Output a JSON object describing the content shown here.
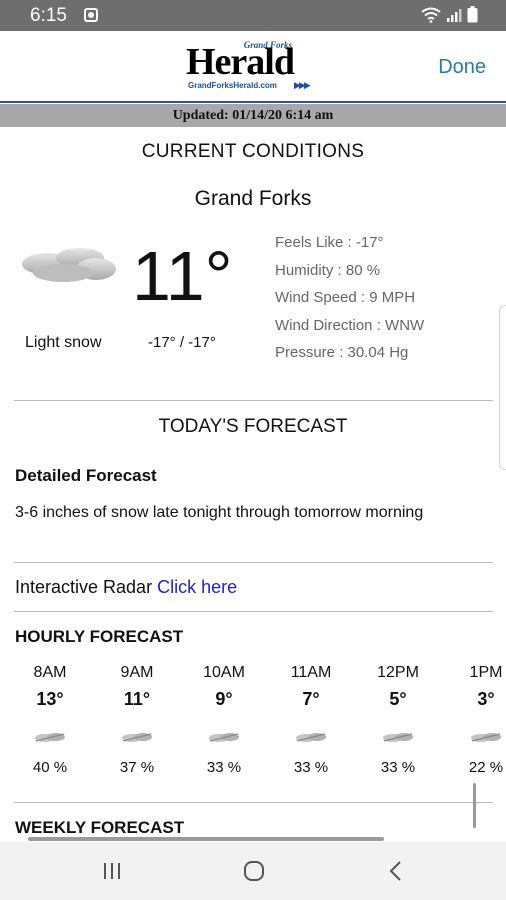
{
  "status_bar": {
    "time": "6:15"
  },
  "header": {
    "logo_small": "Grand Forks",
    "logo_big": "Herald",
    "logo_url": "GrandForksHerald.com",
    "done_label": "Done"
  },
  "updated": "Updated: 01/14/20 6:14 am",
  "current": {
    "title": "CURRENT CONDITIONS",
    "city": "Grand Forks",
    "temperature": "11°",
    "condition": "Light snow",
    "hi_lo": "-17° / -17°",
    "feels_like": "Feels Like : -17°",
    "humidity": "Humidity : 80 %",
    "wind_speed": "Wind Speed : 9 MPH",
    "wind_direction": "Wind Direction : WNW",
    "pressure": "Pressure : 30.04 Hg"
  },
  "today": {
    "title": "TODAY'S FORECAST",
    "detailed_title": "Detailed Forecast",
    "detailed_text": "3-6 inches of snow late tonight through tomorrow morning",
    "radar_label": "Interactive Radar",
    "radar_link": "Click here"
  },
  "hourly": {
    "title": "HOURLY FORECAST",
    "hours": [
      {
        "time": "8AM",
        "temp": "13°",
        "precip": "40 %"
      },
      {
        "time": "9AM",
        "temp": "11°",
        "precip": "37 %"
      },
      {
        "time": "10AM",
        "temp": "9°",
        "precip": "33 %"
      },
      {
        "time": "11AM",
        "temp": "7°",
        "precip": "33 %"
      },
      {
        "time": "12PM",
        "temp": "5°",
        "precip": "33 %"
      },
      {
        "time": "1PM",
        "temp": "3°",
        "precip": "22 %"
      }
    ]
  },
  "weekly": {
    "title": "WEEKLY FORECAST"
  },
  "icons": {
    "current": "cloud-icon",
    "hourly": "snow-cloud-icon"
  },
  "colors": {
    "status_bar": "#6e6e6e",
    "header_line": "#3b4aa8",
    "updated_bar": "#a8a8a8",
    "done": "#2a7b9e",
    "link": "#2222cc",
    "detail_text": "#666666"
  }
}
